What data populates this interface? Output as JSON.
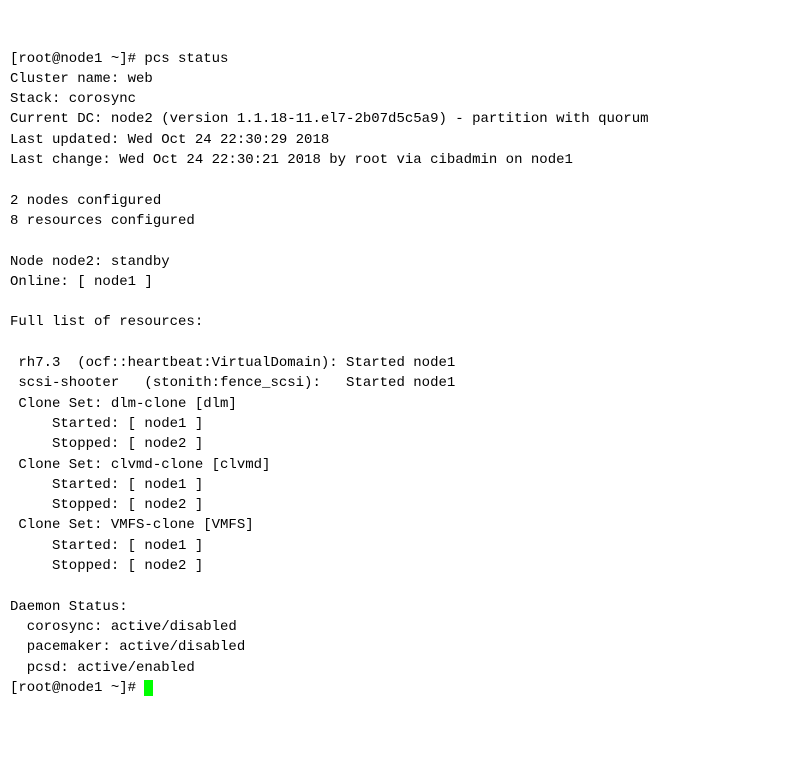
{
  "prompt1": "[root@node1 ~]# ",
  "cmd": "pcs status",
  "cluster_name_line": "Cluster name: web",
  "stack_line": "Stack: corosync",
  "current_dc_line": "Current DC: node2 (version 1.1.18-11.el7-2b07d5c5a9) - partition with quorum",
  "last_updated_line": "Last updated: Wed Oct 24 22:30:29 2018",
  "last_change_line": "Last change: Wed Oct 24 22:30:21 2018 by root via cibadmin on node1",
  "nodes_configured_line": "2 nodes configured",
  "resources_configured_line": "8 resources configured",
  "node_standby_line": "Node node2: standby",
  "online_line": "Online: [ node1 ]",
  "full_list_line": "Full list of resources:",
  "res_rh73_line": " rh7.3  (ocf::heartbeat:VirtualDomain): Started node1",
  "res_scsi_line": " scsi-shooter   (stonith:fence_scsi):   Started node1",
  "clone_dlm_line": " Clone Set: dlm-clone [dlm]",
  "dlm_started_line": "     Started: [ node1 ]",
  "dlm_stopped_line": "     Stopped: [ node2 ]",
  "clone_clvmd_line": " Clone Set: clvmd-clone [clvmd]",
  "clvmd_started_line": "     Started: [ node1 ]",
  "clvmd_stopped_line": "     Stopped: [ node2 ]",
  "clone_vmfs_line": " Clone Set: VMFS-clone [VMFS]",
  "vmfs_started_line": "     Started: [ node1 ]",
  "vmfs_stopped_line": "     Stopped: [ node2 ]",
  "daemon_status_line": "Daemon Status:",
  "corosync_status_line": "  corosync: active/disabled",
  "pacemaker_status_line": "  pacemaker: active/disabled",
  "pcsd_status_line": "  pcsd: active/enabled",
  "prompt2": "[root@node1 ~]# "
}
